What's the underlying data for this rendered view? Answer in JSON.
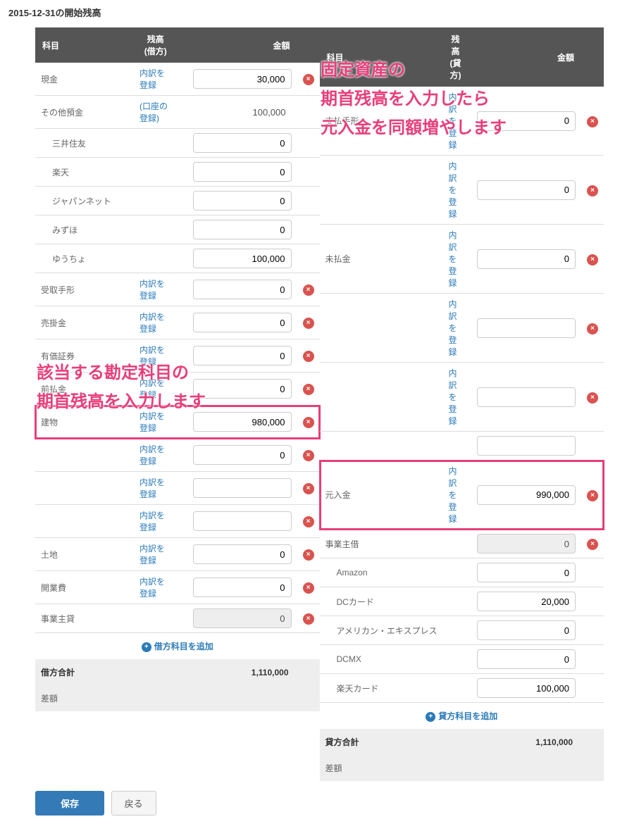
{
  "page_title": "2015-12-31の開始残高",
  "headers": {
    "subject": "科目",
    "debit_balance": "残高 (借方)",
    "credit_balance": "残高 (貸方)",
    "amount": "金額"
  },
  "link_labels": {
    "register_detail": "内訳を登録",
    "register_account": "(口座の登録)"
  },
  "debit_rows": [
    {
      "subject": "現金",
      "link": "register_detail",
      "value": "30,000",
      "deletable": true
    },
    {
      "subject": "その他預金",
      "link": "register_account",
      "value": "100,000",
      "static": true
    },
    {
      "subject": "三井住友",
      "indent": true,
      "value": "0"
    },
    {
      "subject": "楽天",
      "indent": true,
      "value": "0"
    },
    {
      "subject": "ジャパンネット",
      "indent": true,
      "value": "0"
    },
    {
      "subject": "みずほ",
      "indent": true,
      "value": "0"
    },
    {
      "subject": "ゆうちょ",
      "indent": true,
      "value": "100,000"
    },
    {
      "subject": "受取手形",
      "link": "register_detail",
      "value": "0",
      "deletable": true
    },
    {
      "subject": "売掛金",
      "link": "register_detail",
      "value": "0",
      "deletable": true
    },
    {
      "subject": "有価証券",
      "link": "register_detail",
      "value": "0",
      "deletable": true
    },
    {
      "subject": "前払金",
      "link": "register_detail",
      "value": "0",
      "deletable": true
    },
    {
      "subject": "建物",
      "link": "register_detail",
      "value": "980,000",
      "deletable": true,
      "highlight": true
    },
    {
      "subject": "",
      "link": "register_detail",
      "value": "0",
      "deletable": true,
      "obscured": true
    },
    {
      "subject": "",
      "link": "register_detail",
      "value": "",
      "deletable": true,
      "obscured": true
    },
    {
      "subject": "",
      "link": "register_detail",
      "value": "",
      "deletable": true,
      "obscured": true
    },
    {
      "subject": "土地",
      "link": "register_detail",
      "value": "0",
      "deletable": true
    },
    {
      "subject": "開業費",
      "link": "register_detail",
      "value": "0",
      "deletable": true
    },
    {
      "subject": "事業主貸",
      "value": "0",
      "disabled": true,
      "deletable": true
    }
  ],
  "credit_rows": [
    {
      "subject": "支払手形",
      "link": "register_detail",
      "value": "0",
      "deletable": true
    },
    {
      "subject": "",
      "link": "register_detail",
      "value": "0",
      "deletable": true,
      "obscured": true
    },
    {
      "subject": "未払金",
      "link": "register_detail",
      "value": "0",
      "deletable": true
    },
    {
      "subject": "",
      "link": "register_detail",
      "value": "",
      "deletable": true,
      "obscured": true
    },
    {
      "subject": "",
      "link": "register_detail",
      "value": "",
      "deletable": true,
      "obscured": true
    },
    {
      "subject": "",
      "link": "",
      "value": "",
      "obscured": true
    },
    {
      "subject": "元入金",
      "link": "register_detail",
      "value": "990,000",
      "deletable": true,
      "highlight": true
    },
    {
      "subject": "事業主借",
      "value": "0",
      "disabled": true,
      "deletable": true
    },
    {
      "subject": "Amazon",
      "indent": true,
      "value": "0"
    },
    {
      "subject": "DCカード",
      "indent": true,
      "value": "20,000"
    },
    {
      "subject": "アメリカン・エキスプレス",
      "indent": true,
      "value": "0"
    },
    {
      "subject": "DCMX",
      "indent": true,
      "value": "0"
    },
    {
      "subject": "楽天カード",
      "indent": true,
      "value": "100,000"
    }
  ],
  "add_labels": {
    "debit": "借方科目を追加",
    "credit": "貸方科目を追加"
  },
  "totals": {
    "debit_label": "借方合計",
    "debit_value": "1,110,000",
    "credit_label": "貸方合計",
    "credit_value": "1,110,000",
    "diff_label": "差額"
  },
  "buttons": {
    "save": "保存",
    "back": "戻る"
  },
  "annotations": {
    "a1": "固定資産の\n期首残高を入力したら\n元入金を同額増やします",
    "a2": "該当する勘定科目の\n期首残高を入力します"
  }
}
